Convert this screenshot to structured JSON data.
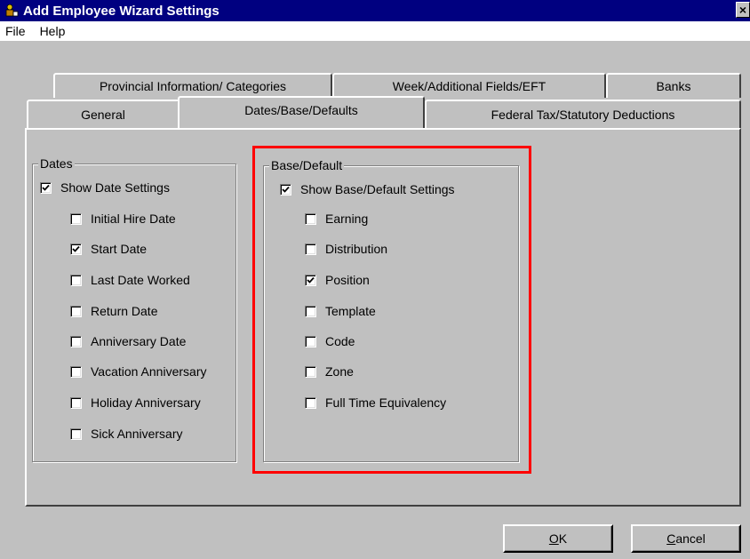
{
  "window": {
    "title": "Add Employee Wizard Settings",
    "close_label": "×"
  },
  "menu": {
    "file": "File",
    "help": "Help"
  },
  "tabs": {
    "row1": [
      "Provincial Information/ Categories",
      "Week/Additional Fields/EFT",
      "Banks"
    ],
    "row2": [
      "General",
      "Dates/Base/Defaults",
      "Federal Tax/Statutory Deductions"
    ],
    "active": "Dates/Base/Defaults"
  },
  "dates": {
    "legend": "Dates",
    "show_label": "Show Date Settings",
    "show_checked": true,
    "items": [
      {
        "label": "Initial Hire Date",
        "checked": false
      },
      {
        "label": "Start Date",
        "checked": true
      },
      {
        "label": "Last Date Worked",
        "checked": false
      },
      {
        "label": "Return Date",
        "checked": false
      },
      {
        "label": "Anniversary Date",
        "checked": false
      },
      {
        "label": "Vacation Anniversary",
        "checked": false
      },
      {
        "label": "Holiday Anniversary",
        "checked": false
      },
      {
        "label": "Sick Anniversary",
        "checked": false
      }
    ]
  },
  "base": {
    "legend": "Base/Default",
    "show_label": "Show Base/Default Settings",
    "show_checked": true,
    "items": [
      {
        "label": "Earning",
        "checked": false
      },
      {
        "label": "Distribution",
        "checked": false
      },
      {
        "label": "Position",
        "checked": true
      },
      {
        "label": "Template",
        "checked": false
      },
      {
        "label": "Code",
        "checked": false
      },
      {
        "label": "Zone",
        "checked": false
      },
      {
        "label": "Full Time Equivalency",
        "checked": false
      }
    ]
  },
  "buttons": {
    "ok_mnemonic": "O",
    "ok_rest": "K",
    "cancel_mnemonic": "C",
    "cancel_rest": "ancel"
  },
  "colors": {
    "titlebar": "#000080",
    "face": "#c0c0c0",
    "highlight": "#ff0000"
  }
}
